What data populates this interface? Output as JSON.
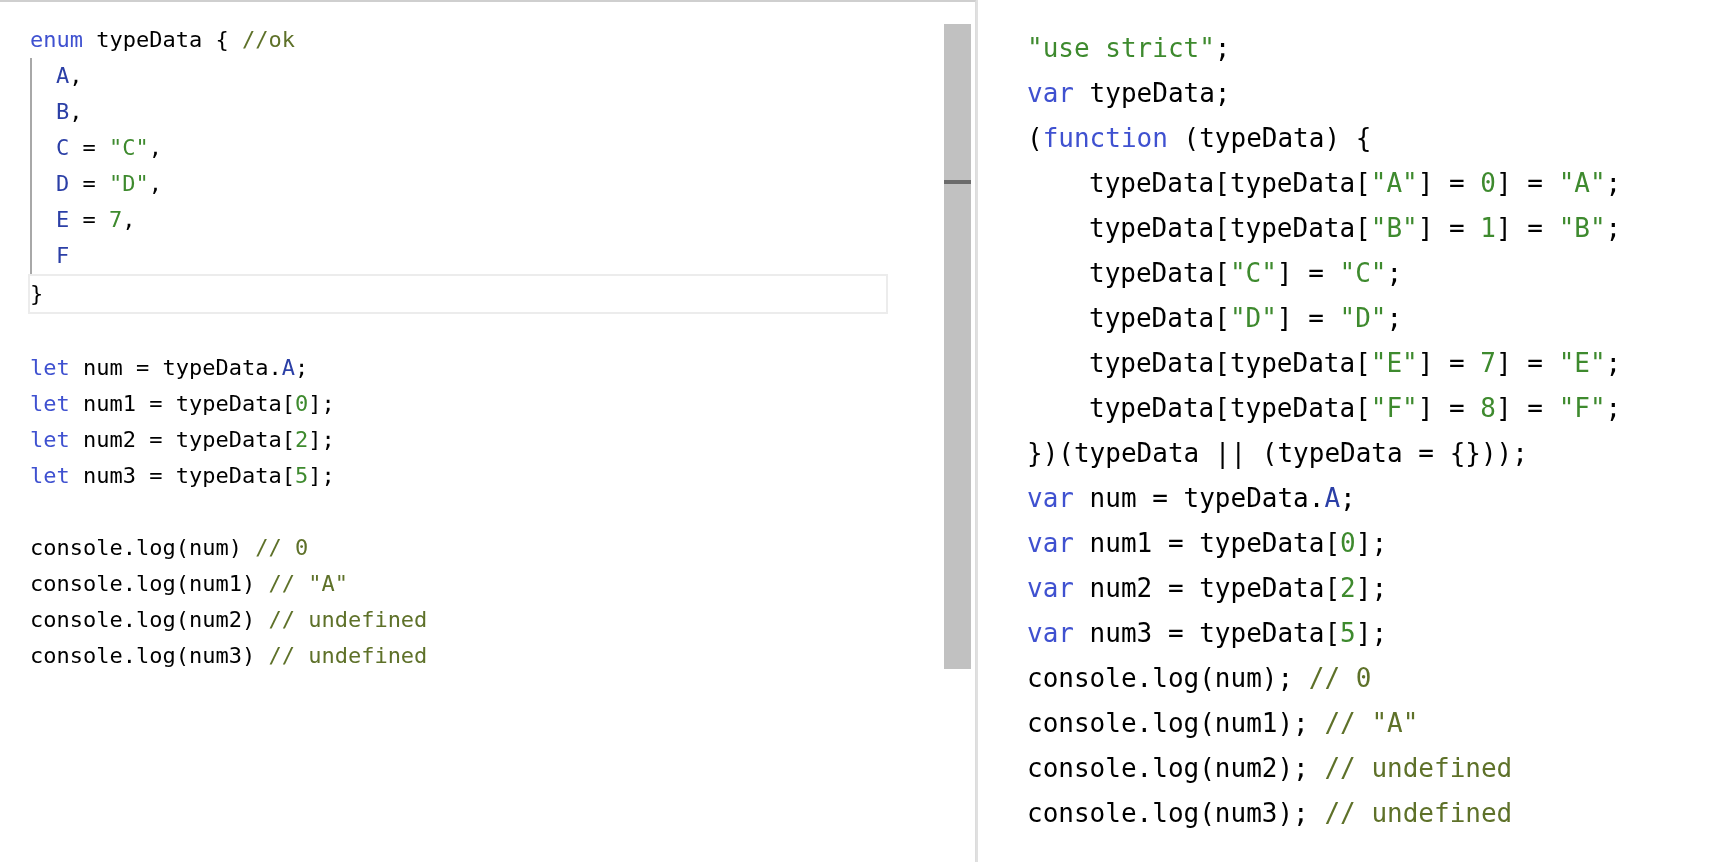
{
  "editor": {
    "indent_guides": true,
    "lines": [
      {
        "tokens": [
          {
            "kind": "keyword",
            "text": "enum"
          },
          {
            "kind": "plain",
            "text": " typeData { "
          },
          {
            "kind": "comment",
            "text": "//ok"
          }
        ],
        "children": [
          {
            "tokens": [
              {
                "kind": "member",
                "text": "A"
              },
              {
                "kind": "plain",
                "text": ","
              }
            ]
          },
          {
            "tokens": [
              {
                "kind": "member",
                "text": "B"
              },
              {
                "kind": "plain",
                "text": ","
              }
            ]
          },
          {
            "tokens": [
              {
                "kind": "member",
                "text": "C"
              },
              {
                "kind": "plain",
                "text": " = "
              },
              {
                "kind": "string",
                "text": "\"C\""
              },
              {
                "kind": "plain",
                "text": ","
              }
            ]
          },
          {
            "tokens": [
              {
                "kind": "member",
                "text": "D"
              },
              {
                "kind": "plain",
                "text": " = "
              },
              {
                "kind": "string",
                "text": "\"D\""
              },
              {
                "kind": "plain",
                "text": ","
              }
            ]
          },
          {
            "tokens": [
              {
                "kind": "member",
                "text": "E"
              },
              {
                "kind": "plain",
                "text": " = "
              },
              {
                "kind": "number",
                "text": "7"
              },
              {
                "kind": "plain",
                "text": ","
              }
            ]
          },
          {
            "tokens": [
              {
                "kind": "member",
                "text": "F"
              }
            ]
          }
        ]
      },
      {
        "current": true,
        "tokens": [
          {
            "kind": "plain",
            "text": "}"
          }
        ]
      },
      {
        "space_before": true,
        "tokens": [
          {
            "kind": "keyword",
            "text": "let"
          },
          {
            "kind": "plain",
            "text": " num = typeData."
          },
          {
            "kind": "member",
            "text": "A"
          },
          {
            "kind": "plain",
            "text": ";"
          }
        ]
      },
      {
        "tokens": [
          {
            "kind": "keyword",
            "text": "let"
          },
          {
            "kind": "plain",
            "text": " num1 = typeData["
          },
          {
            "kind": "number",
            "text": "0"
          },
          {
            "kind": "plain",
            "text": "];"
          }
        ]
      },
      {
        "tokens": [
          {
            "kind": "keyword",
            "text": "let"
          },
          {
            "kind": "plain",
            "text": " num2 = typeData["
          },
          {
            "kind": "number",
            "text": "2"
          },
          {
            "kind": "plain",
            "text": "];"
          }
        ]
      },
      {
        "tokens": [
          {
            "kind": "keyword",
            "text": "let"
          },
          {
            "kind": "plain",
            "text": " num3 = typeData["
          },
          {
            "kind": "number",
            "text": "5"
          },
          {
            "kind": "plain",
            "text": "];"
          }
        ]
      },
      {
        "space_before": true,
        "tokens": [
          {
            "kind": "plain",
            "text": "console.log(num) "
          },
          {
            "kind": "comment",
            "text": "// 0"
          }
        ]
      },
      {
        "tokens": [
          {
            "kind": "plain",
            "text": "console.log(num1) "
          },
          {
            "kind": "comment",
            "text": "// \"A\""
          }
        ]
      },
      {
        "tokens": [
          {
            "kind": "plain",
            "text": "console.log(num2) "
          },
          {
            "kind": "comment",
            "text": "// undefined"
          }
        ]
      },
      {
        "tokens": [
          {
            "kind": "plain",
            "text": "console.log(num3) "
          },
          {
            "kind": "comment",
            "text": "// undefined"
          }
        ]
      }
    ]
  },
  "output": {
    "lines": [
      {
        "tokens": [
          {
            "kind": "string",
            "text": "\"use strict\""
          },
          {
            "kind": "plain",
            "text": ";"
          }
        ]
      },
      {
        "tokens": [
          {
            "kind": "keyword",
            "text": "var"
          },
          {
            "kind": "plain",
            "text": " typeData;"
          }
        ]
      },
      {
        "tokens": [
          {
            "kind": "plain",
            "text": "("
          },
          {
            "kind": "keyword",
            "text": "function"
          },
          {
            "kind": "plain",
            "text": " (typeData) {"
          }
        ],
        "children": [
          {
            "tokens": [
              {
                "kind": "plain",
                "text": "typeData[typeData["
              },
              {
                "kind": "string",
                "text": "\"A\""
              },
              {
                "kind": "plain",
                "text": "] = "
              },
              {
                "kind": "number",
                "text": "0"
              },
              {
                "kind": "plain",
                "text": "] = "
              },
              {
                "kind": "string",
                "text": "\"A\""
              },
              {
                "kind": "plain",
                "text": ";"
              }
            ]
          },
          {
            "tokens": [
              {
                "kind": "plain",
                "text": "typeData[typeData["
              },
              {
                "kind": "string",
                "text": "\"B\""
              },
              {
                "kind": "plain",
                "text": "] = "
              },
              {
                "kind": "number",
                "text": "1"
              },
              {
                "kind": "plain",
                "text": "] = "
              },
              {
                "kind": "string",
                "text": "\"B\""
              },
              {
                "kind": "plain",
                "text": ";"
              }
            ]
          },
          {
            "tokens": [
              {
                "kind": "plain",
                "text": "typeData["
              },
              {
                "kind": "string",
                "text": "\"C\""
              },
              {
                "kind": "plain",
                "text": "] = "
              },
              {
                "kind": "string",
                "text": "\"C\""
              },
              {
                "kind": "plain",
                "text": ";"
              }
            ]
          },
          {
            "tokens": [
              {
                "kind": "plain",
                "text": "typeData["
              },
              {
                "kind": "string",
                "text": "\"D\""
              },
              {
                "kind": "plain",
                "text": "] = "
              },
              {
                "kind": "string",
                "text": "\"D\""
              },
              {
                "kind": "plain",
                "text": ";"
              }
            ]
          },
          {
            "tokens": [
              {
                "kind": "plain",
                "text": "typeData[typeData["
              },
              {
                "kind": "string",
                "text": "\"E\""
              },
              {
                "kind": "plain",
                "text": "] = "
              },
              {
                "kind": "number",
                "text": "7"
              },
              {
                "kind": "plain",
                "text": "] = "
              },
              {
                "kind": "string",
                "text": "\"E\""
              },
              {
                "kind": "plain",
                "text": ";"
              }
            ]
          },
          {
            "tokens": [
              {
                "kind": "plain",
                "text": "typeData[typeData["
              },
              {
                "kind": "string",
                "text": "\"F\""
              },
              {
                "kind": "plain",
                "text": "] = "
              },
              {
                "kind": "number",
                "text": "8"
              },
              {
                "kind": "plain",
                "text": "] = "
              },
              {
                "kind": "string",
                "text": "\"F\""
              },
              {
                "kind": "plain",
                "text": ";"
              }
            ]
          }
        ]
      },
      {
        "tokens": [
          {
            "kind": "plain",
            "text": "})(typeData || (typeData = {}));"
          }
        ]
      },
      {
        "tokens": [
          {
            "kind": "keyword",
            "text": "var"
          },
          {
            "kind": "plain",
            "text": " num = typeData."
          },
          {
            "kind": "member",
            "text": "A"
          },
          {
            "kind": "plain",
            "text": ";"
          }
        ]
      },
      {
        "tokens": [
          {
            "kind": "keyword",
            "text": "var"
          },
          {
            "kind": "plain",
            "text": " num1 = typeData["
          },
          {
            "kind": "number",
            "text": "0"
          },
          {
            "kind": "plain",
            "text": "];"
          }
        ]
      },
      {
        "tokens": [
          {
            "kind": "keyword",
            "text": "var"
          },
          {
            "kind": "plain",
            "text": " num2 = typeData["
          },
          {
            "kind": "number",
            "text": "2"
          },
          {
            "kind": "plain",
            "text": "];"
          }
        ]
      },
      {
        "tokens": [
          {
            "kind": "keyword",
            "text": "var"
          },
          {
            "kind": "plain",
            "text": " num3 = typeData["
          },
          {
            "kind": "number",
            "text": "5"
          },
          {
            "kind": "plain",
            "text": "];"
          }
        ]
      },
      {
        "tokens": [
          {
            "kind": "plain",
            "text": "console.log(num); "
          },
          {
            "kind": "comment",
            "text": "// 0"
          }
        ]
      },
      {
        "tokens": [
          {
            "kind": "plain",
            "text": "console.log(num1); "
          },
          {
            "kind": "comment",
            "text": "// \"A\""
          }
        ]
      },
      {
        "tokens": [
          {
            "kind": "plain",
            "text": "console.log(num2); "
          },
          {
            "kind": "comment",
            "text": "// undefined"
          }
        ]
      },
      {
        "tokens": [
          {
            "kind": "plain",
            "text": "console.log(num3); "
          },
          {
            "kind": "comment",
            "text": "// undefined"
          }
        ]
      }
    ]
  }
}
